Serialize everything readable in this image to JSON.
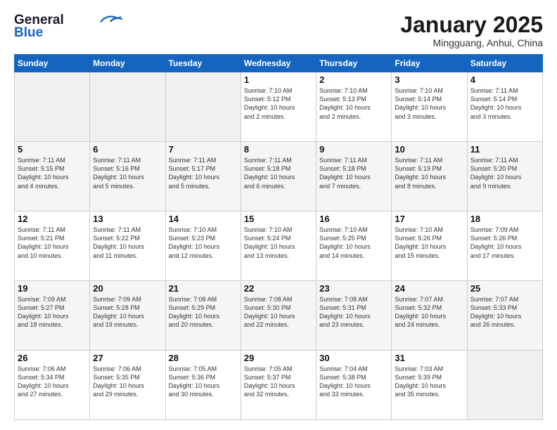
{
  "logo": {
    "line1": "General",
    "line2": "Blue"
  },
  "header": {
    "title": "January 2025",
    "subtitle": "Mingguang, Anhui, China"
  },
  "days_of_week": [
    "Sunday",
    "Monday",
    "Tuesday",
    "Wednesday",
    "Thursday",
    "Friday",
    "Saturday"
  ],
  "weeks": [
    [
      {
        "day": "",
        "info": ""
      },
      {
        "day": "",
        "info": ""
      },
      {
        "day": "",
        "info": ""
      },
      {
        "day": "1",
        "info": "Sunrise: 7:10 AM\nSunset: 5:12 PM\nDaylight: 10 hours\nand 2 minutes."
      },
      {
        "day": "2",
        "info": "Sunrise: 7:10 AM\nSunset: 5:13 PM\nDaylight: 10 hours\nand 2 minutes."
      },
      {
        "day": "3",
        "info": "Sunrise: 7:10 AM\nSunset: 5:14 PM\nDaylight: 10 hours\nand 3 minutes."
      },
      {
        "day": "4",
        "info": "Sunrise: 7:11 AM\nSunset: 5:14 PM\nDaylight: 10 hours\nand 3 minutes."
      }
    ],
    [
      {
        "day": "5",
        "info": "Sunrise: 7:11 AM\nSunset: 5:15 PM\nDaylight: 10 hours\nand 4 minutes."
      },
      {
        "day": "6",
        "info": "Sunrise: 7:11 AM\nSunset: 5:16 PM\nDaylight: 10 hours\nand 5 minutes."
      },
      {
        "day": "7",
        "info": "Sunrise: 7:11 AM\nSunset: 5:17 PM\nDaylight: 10 hours\nand 5 minutes."
      },
      {
        "day": "8",
        "info": "Sunrise: 7:11 AM\nSunset: 5:18 PM\nDaylight: 10 hours\nand 6 minutes."
      },
      {
        "day": "9",
        "info": "Sunrise: 7:11 AM\nSunset: 5:18 PM\nDaylight: 10 hours\nand 7 minutes."
      },
      {
        "day": "10",
        "info": "Sunrise: 7:11 AM\nSunset: 5:19 PM\nDaylight: 10 hours\nand 8 minutes."
      },
      {
        "day": "11",
        "info": "Sunrise: 7:11 AM\nSunset: 5:20 PM\nDaylight: 10 hours\nand 9 minutes."
      }
    ],
    [
      {
        "day": "12",
        "info": "Sunrise: 7:11 AM\nSunset: 5:21 PM\nDaylight: 10 hours\nand 10 minutes."
      },
      {
        "day": "13",
        "info": "Sunrise: 7:11 AM\nSunset: 5:22 PM\nDaylight: 10 hours\nand 11 minutes."
      },
      {
        "day": "14",
        "info": "Sunrise: 7:10 AM\nSunset: 5:23 PM\nDaylight: 10 hours\nand 12 minutes."
      },
      {
        "day": "15",
        "info": "Sunrise: 7:10 AM\nSunset: 5:24 PM\nDaylight: 10 hours\nand 13 minutes."
      },
      {
        "day": "16",
        "info": "Sunrise: 7:10 AM\nSunset: 5:25 PM\nDaylight: 10 hours\nand 14 minutes."
      },
      {
        "day": "17",
        "info": "Sunrise: 7:10 AM\nSunset: 5:26 PM\nDaylight: 10 hours\nand 15 minutes."
      },
      {
        "day": "18",
        "info": "Sunrise: 7:09 AM\nSunset: 5:26 PM\nDaylight: 10 hours\nand 17 minutes."
      }
    ],
    [
      {
        "day": "19",
        "info": "Sunrise: 7:09 AM\nSunset: 5:27 PM\nDaylight: 10 hours\nand 18 minutes."
      },
      {
        "day": "20",
        "info": "Sunrise: 7:09 AM\nSunset: 5:28 PM\nDaylight: 10 hours\nand 19 minutes."
      },
      {
        "day": "21",
        "info": "Sunrise: 7:08 AM\nSunset: 5:29 PM\nDaylight: 10 hours\nand 20 minutes."
      },
      {
        "day": "22",
        "info": "Sunrise: 7:08 AM\nSunset: 5:30 PM\nDaylight: 10 hours\nand 22 minutes."
      },
      {
        "day": "23",
        "info": "Sunrise: 7:08 AM\nSunset: 5:31 PM\nDaylight: 10 hours\nand 23 minutes."
      },
      {
        "day": "24",
        "info": "Sunrise: 7:07 AM\nSunset: 5:32 PM\nDaylight: 10 hours\nand 24 minutes."
      },
      {
        "day": "25",
        "info": "Sunrise: 7:07 AM\nSunset: 5:33 PM\nDaylight: 10 hours\nand 26 minutes."
      }
    ],
    [
      {
        "day": "26",
        "info": "Sunrise: 7:06 AM\nSunset: 5:34 PM\nDaylight: 10 hours\nand 27 minutes."
      },
      {
        "day": "27",
        "info": "Sunrise: 7:06 AM\nSunset: 5:35 PM\nDaylight: 10 hours\nand 29 minutes."
      },
      {
        "day": "28",
        "info": "Sunrise: 7:05 AM\nSunset: 5:36 PM\nDaylight: 10 hours\nand 30 minutes."
      },
      {
        "day": "29",
        "info": "Sunrise: 7:05 AM\nSunset: 5:37 PM\nDaylight: 10 hours\nand 32 minutes."
      },
      {
        "day": "30",
        "info": "Sunrise: 7:04 AM\nSunset: 5:38 PM\nDaylight: 10 hours\nand 33 minutes."
      },
      {
        "day": "31",
        "info": "Sunrise: 7:03 AM\nSunset: 5:39 PM\nDaylight: 10 hours\nand 35 minutes."
      },
      {
        "day": "",
        "info": ""
      }
    ]
  ]
}
